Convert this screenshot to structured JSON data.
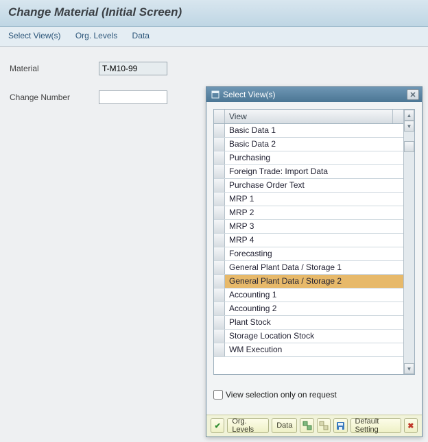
{
  "title": "Change Material (Initial Screen)",
  "toolbar": {
    "select_views": "Select View(s)",
    "org_levels": "Org. Levels",
    "data": "Data"
  },
  "form": {
    "material_label": "Material",
    "material_value": "T-M10-99",
    "change_number_label": "Change Number",
    "change_number_value": ""
  },
  "dialog": {
    "title": "Select View(s)",
    "column_header": "View",
    "views": [
      "Basic Data 1",
      "Basic Data 2",
      "Purchasing",
      "Foreign Trade: Import Data",
      "Purchase Order Text",
      "MRP 1",
      "MRP 2",
      "MRP 3",
      "MRP 4",
      "Forecasting",
      "General Plant Data / Storage 1",
      "General Plant Data / Storage 2",
      "Accounting 1",
      "Accounting 2",
      "Plant Stock",
      "Storage Location Stock",
      "WM Execution"
    ],
    "selected_index": 11,
    "option_label": "View selection only on request"
  },
  "footer": {
    "confirm": "",
    "org_levels": "Org. Levels",
    "data": "Data",
    "default_setting": "Default Setting"
  }
}
